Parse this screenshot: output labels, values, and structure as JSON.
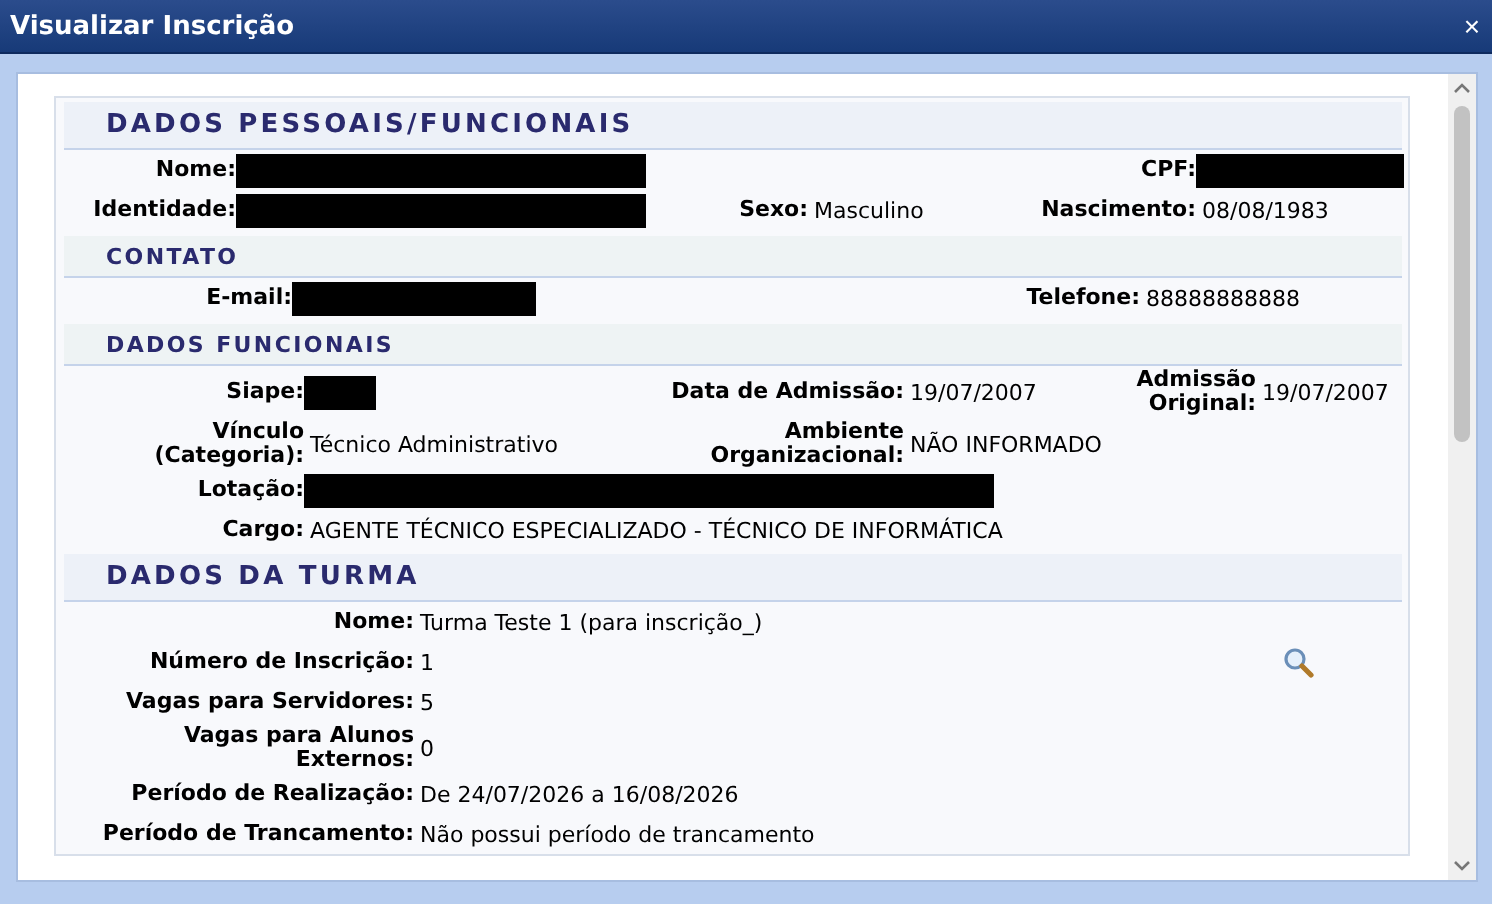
{
  "window": {
    "title": "Visualizar Inscrição",
    "close": "×"
  },
  "sections": [
    {
      "title": "DADOS PESSOAIS/FUNCIONAIS",
      "kind": "main",
      "rows": [
        [
          {
            "label": "Nome:",
            "redacted": true
          },
          {},
          {
            "label": "CPF:",
            "redacted": true
          }
        ],
        [
          {
            "label": "Identidade:",
            "redacted": true
          },
          {
            "label": "Sexo:",
            "value": "Masculino"
          },
          {
            "label": "Nascimento:",
            "value": "08/08/1983"
          }
        ]
      ]
    },
    {
      "title": "CONTATO",
      "kind": "sub",
      "rows": [
        [
          {
            "label": "E-mail:",
            "redacted": true
          },
          {
            "label": "Telefone:",
            "value": "88888888888"
          }
        ]
      ]
    },
    {
      "title": "DADOS FUNCIONAIS",
      "kind": "sub",
      "rows": [
        [
          {
            "label": "Siape:",
            "redacted": true
          },
          {
            "label": "Data de Admissão:",
            "value": "19/07/2007"
          },
          {
            "label": "Admissão\nOriginal:",
            "value": "19/07/2007"
          }
        ],
        [
          {
            "label": "Vínculo\n(Categoria):",
            "value": "Técnico Administrativo"
          },
          {
            "label": "Ambiente\nOrganizacional:",
            "value": "NÃO INFORMADO"
          }
        ],
        [
          {
            "label": "Lotação:",
            "redacted": true
          }
        ],
        [
          {
            "label": "Cargo:",
            "value": "AGENTE TÉCNICO ESPECIALIZADO - TÉCNICO DE INFORMÁTICA"
          }
        ]
      ]
    },
    {
      "title": "DADOS DA TURMA",
      "kind": "main",
      "rows": [
        [
          {
            "label": "Nome:",
            "value": "Turma Teste 1 (para inscrição_)"
          }
        ],
        [
          {
            "label": "Número de Inscrição:",
            "value": "1",
            "details_button": true
          }
        ],
        [
          {
            "label": "Vagas para Servidores:",
            "value": "5"
          }
        ],
        [
          {
            "label": "Vagas para Alunos\nExternos:",
            "value": "0"
          }
        ],
        [
          {
            "label": "Período de Realização:",
            "value": "De 24/07/2026 a 16/08/2026"
          }
        ],
        [
          {
            "label": "Período de Trancamento:",
            "value": "Não possui período de trancamento"
          }
        ]
      ]
    }
  ]
}
